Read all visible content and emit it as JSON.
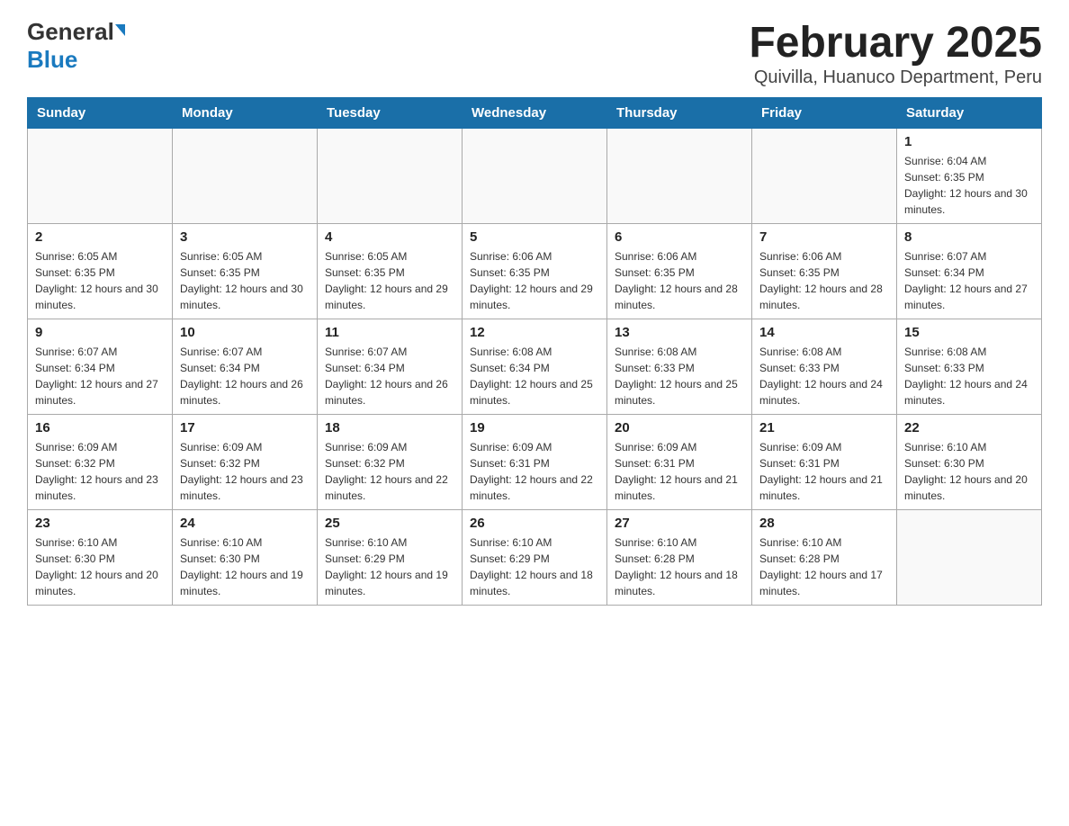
{
  "header": {
    "logo_general": "General",
    "logo_blue": "Blue",
    "title": "February 2025",
    "subtitle": "Quivilla, Huanuco Department, Peru"
  },
  "days_of_week": [
    "Sunday",
    "Monday",
    "Tuesday",
    "Wednesday",
    "Thursday",
    "Friday",
    "Saturday"
  ],
  "weeks": [
    [
      {
        "date": "",
        "info": ""
      },
      {
        "date": "",
        "info": ""
      },
      {
        "date": "",
        "info": ""
      },
      {
        "date": "",
        "info": ""
      },
      {
        "date": "",
        "info": ""
      },
      {
        "date": "",
        "info": ""
      },
      {
        "date": "1",
        "sunrise": "6:04 AM",
        "sunset": "6:35 PM",
        "daylight": "12 hours and 30 minutes."
      }
    ],
    [
      {
        "date": "2",
        "sunrise": "6:05 AM",
        "sunset": "6:35 PM",
        "daylight": "12 hours and 30 minutes."
      },
      {
        "date": "3",
        "sunrise": "6:05 AM",
        "sunset": "6:35 PM",
        "daylight": "12 hours and 30 minutes."
      },
      {
        "date": "4",
        "sunrise": "6:05 AM",
        "sunset": "6:35 PM",
        "daylight": "12 hours and 29 minutes."
      },
      {
        "date": "5",
        "sunrise": "6:06 AM",
        "sunset": "6:35 PM",
        "daylight": "12 hours and 29 minutes."
      },
      {
        "date": "6",
        "sunrise": "6:06 AM",
        "sunset": "6:35 PM",
        "daylight": "12 hours and 28 minutes."
      },
      {
        "date": "7",
        "sunrise": "6:06 AM",
        "sunset": "6:35 PM",
        "daylight": "12 hours and 28 minutes."
      },
      {
        "date": "8",
        "sunrise": "6:07 AM",
        "sunset": "6:34 PM",
        "daylight": "12 hours and 27 minutes."
      }
    ],
    [
      {
        "date": "9",
        "sunrise": "6:07 AM",
        "sunset": "6:34 PM",
        "daylight": "12 hours and 27 minutes."
      },
      {
        "date": "10",
        "sunrise": "6:07 AM",
        "sunset": "6:34 PM",
        "daylight": "12 hours and 26 minutes."
      },
      {
        "date": "11",
        "sunrise": "6:07 AM",
        "sunset": "6:34 PM",
        "daylight": "12 hours and 26 minutes."
      },
      {
        "date": "12",
        "sunrise": "6:08 AM",
        "sunset": "6:34 PM",
        "daylight": "12 hours and 25 minutes."
      },
      {
        "date": "13",
        "sunrise": "6:08 AM",
        "sunset": "6:33 PM",
        "daylight": "12 hours and 25 minutes."
      },
      {
        "date": "14",
        "sunrise": "6:08 AM",
        "sunset": "6:33 PM",
        "daylight": "12 hours and 24 minutes."
      },
      {
        "date": "15",
        "sunrise": "6:08 AM",
        "sunset": "6:33 PM",
        "daylight": "12 hours and 24 minutes."
      }
    ],
    [
      {
        "date": "16",
        "sunrise": "6:09 AM",
        "sunset": "6:32 PM",
        "daylight": "12 hours and 23 minutes."
      },
      {
        "date": "17",
        "sunrise": "6:09 AM",
        "sunset": "6:32 PM",
        "daylight": "12 hours and 23 minutes."
      },
      {
        "date": "18",
        "sunrise": "6:09 AM",
        "sunset": "6:32 PM",
        "daylight": "12 hours and 22 minutes."
      },
      {
        "date": "19",
        "sunrise": "6:09 AM",
        "sunset": "6:31 PM",
        "daylight": "12 hours and 22 minutes."
      },
      {
        "date": "20",
        "sunrise": "6:09 AM",
        "sunset": "6:31 PM",
        "daylight": "12 hours and 21 minutes."
      },
      {
        "date": "21",
        "sunrise": "6:09 AM",
        "sunset": "6:31 PM",
        "daylight": "12 hours and 21 minutes."
      },
      {
        "date": "22",
        "sunrise": "6:10 AM",
        "sunset": "6:30 PM",
        "daylight": "12 hours and 20 minutes."
      }
    ],
    [
      {
        "date": "23",
        "sunrise": "6:10 AM",
        "sunset": "6:30 PM",
        "daylight": "12 hours and 20 minutes."
      },
      {
        "date": "24",
        "sunrise": "6:10 AM",
        "sunset": "6:30 PM",
        "daylight": "12 hours and 19 minutes."
      },
      {
        "date": "25",
        "sunrise": "6:10 AM",
        "sunset": "6:29 PM",
        "daylight": "12 hours and 19 minutes."
      },
      {
        "date": "26",
        "sunrise": "6:10 AM",
        "sunset": "6:29 PM",
        "daylight": "12 hours and 18 minutes."
      },
      {
        "date": "27",
        "sunrise": "6:10 AM",
        "sunset": "6:28 PM",
        "daylight": "12 hours and 18 minutes."
      },
      {
        "date": "28",
        "sunrise": "6:10 AM",
        "sunset": "6:28 PM",
        "daylight": "12 hours and 17 minutes."
      },
      {
        "date": "",
        "info": ""
      }
    ]
  ]
}
